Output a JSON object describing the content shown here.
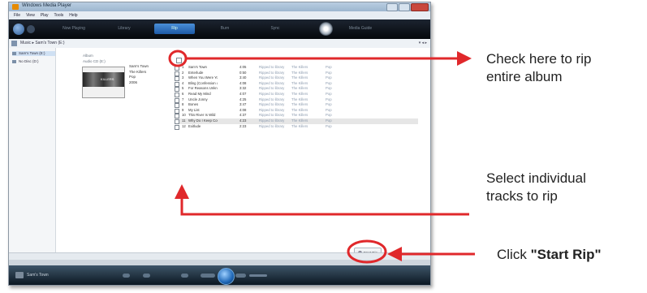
{
  "window": {
    "title": "Windows Media Player",
    "menu": [
      "File",
      "View",
      "Play",
      "Tools",
      "Help"
    ]
  },
  "nav": {
    "tabs": [
      "Now Playing",
      "Library",
      "Rip",
      "Burn",
      "Sync",
      "Media Guide"
    ],
    "active_tab": "Rip"
  },
  "address": {
    "path": "Music ▸ Sam's Town (E:)",
    "right": "▾ ◂ ▸"
  },
  "navpane": {
    "items": [
      "Sam's Town (E:)",
      "No Disc (D:)"
    ]
  },
  "album": {
    "header": "Album",
    "disc": "Audio CD (E:)",
    "cover_caption": "KILLERS",
    "meta": [
      "Sam's Town",
      "The Killers",
      "Pop",
      "2006"
    ]
  },
  "tracks": [
    {
      "no": "1",
      "title": "Sam's Town",
      "length": "4:05",
      "status": "Ripped to library",
      "artist": "The Killers",
      "genre": "Pop"
    },
    {
      "no": "2",
      "title": "Enterlude",
      "length": "0:50",
      "status": "Ripped to library",
      "artist": "The Killers",
      "genre": "Pop"
    },
    {
      "no": "3",
      "title": "When You Were Young",
      "length": "3:40",
      "status": "Ripped to library",
      "artist": "The Killers",
      "genre": "Pop"
    },
    {
      "no": "4",
      "title": "Bling (Confession of a King)",
      "length": "4:08",
      "status": "Ripped to library",
      "artist": "The Killers",
      "genre": "Pop"
    },
    {
      "no": "5",
      "title": "For Reasons Unknown",
      "length": "3:32",
      "status": "Ripped to library",
      "artist": "The Killers",
      "genre": "Pop"
    },
    {
      "no": "6",
      "title": "Read My Mind",
      "length": "4:07",
      "status": "Ripped to library",
      "artist": "The Killers",
      "genre": "Pop"
    },
    {
      "no": "7",
      "title": "Uncle Jonny",
      "length": "4:25",
      "status": "Ripped to library",
      "artist": "The Killers",
      "genre": "Pop"
    },
    {
      "no": "8",
      "title": "Bones",
      "length": "3:47",
      "status": "Ripped to library",
      "artist": "The Killers",
      "genre": "Pop"
    },
    {
      "no": "9",
      "title": "My List",
      "length": "4:08",
      "status": "Ripped to library",
      "artist": "The Killers",
      "genre": "Pop"
    },
    {
      "no": "10",
      "title": "This River Is Wild",
      "length": "4:37",
      "status": "Ripped to library",
      "artist": "The Killers",
      "genre": "Pop"
    },
    {
      "no": "11",
      "title": "Why Do I Keep Counting?",
      "length": "4:23",
      "status": "Ripped to library",
      "artist": "The Killers",
      "genre": "Pop"
    },
    {
      "no": "12",
      "title": "Exitlude",
      "length": "2:23",
      "status": "Ripped to library",
      "artist": "The Killers",
      "genre": "Pop"
    }
  ],
  "rip_button": "Start Rip",
  "player": {
    "now_playing": "Sam's Town"
  },
  "annotations": {
    "check_album": [
      "Check here to rip",
      "entire album"
    ],
    "select_tracks": [
      "Select individual",
      "tracks to rip"
    ],
    "click_prefix": "Click",
    "click_target": "\"Start Rip\""
  },
  "colors": {
    "annotation_red": "#e0282b",
    "active_tab": "#2a6fc0",
    "player_bar": "#0b1722"
  }
}
